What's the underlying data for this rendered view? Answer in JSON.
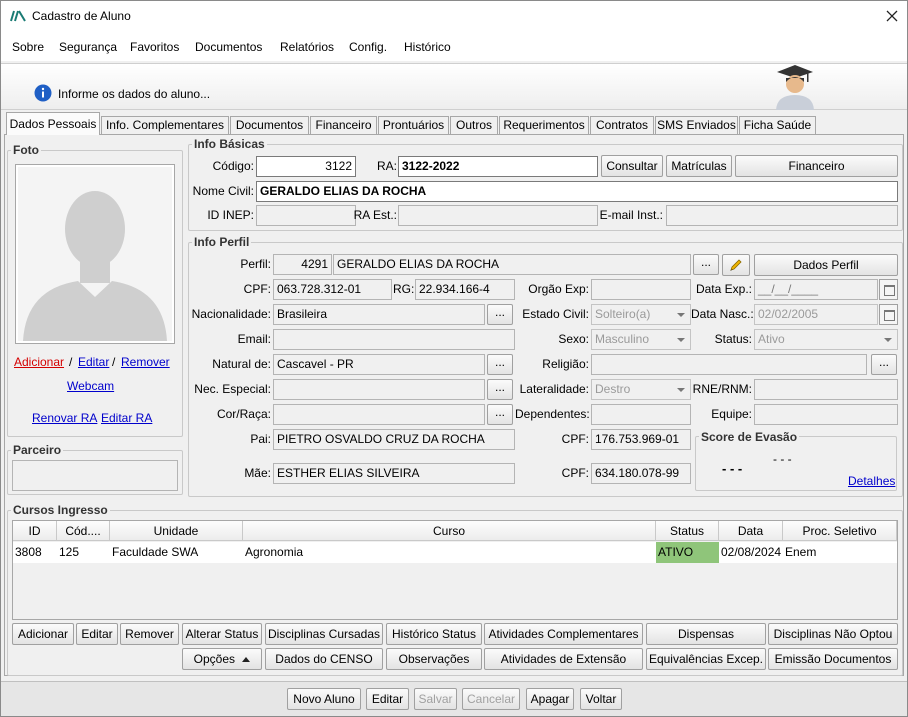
{
  "window": {
    "title": "Cadastro de Aluno"
  },
  "menu": [
    "Sobre",
    "Segurança",
    "Favoritos",
    "Documentos",
    "Relatórios",
    "Config.",
    "Histórico"
  ],
  "banner": {
    "message": "Informe os dados do aluno..."
  },
  "tabs": [
    "Dados Pessoais",
    "Info. Complementares",
    "Documentos",
    "Financeiro",
    "Prontuários",
    "Outros",
    "Requerimentos",
    "Contratos",
    "SMS Enviados",
    "Ficha Saúde"
  ],
  "foto": {
    "title": "Foto",
    "add": "Adicionar",
    "sep1": "/",
    "edit": "Editar",
    "sep2": "/",
    "remove": "Remover",
    "webcam": "Webcam",
    "renovar_ra": "Renovar RA",
    "editar_ra": "Editar RA"
  },
  "parceiro": {
    "title": "Parceiro",
    "value": ""
  },
  "info_basicas": {
    "title": "Info Básicas",
    "codigo_label": "Código:",
    "codigo": "3122",
    "ra_label": "RA:",
    "ra": "3122-2022",
    "consultar": "Consultar",
    "matriculas": "Matrículas",
    "financeiro": "Financeiro",
    "nome_label": "Nome Civil:",
    "nome": "GERALDO ELIAS DA ROCHA",
    "inep_label": "ID INEP:",
    "inep": "",
    "ra_est_label": "RA Est.:",
    "ra_est": "",
    "email_inst_label": "E-mail Inst.:",
    "email_inst": ""
  },
  "info_perfil": {
    "title": "Info Perfil",
    "perfil_label": "Perfil:",
    "perfil_id": "4291",
    "perfil_nome": "GERALDO ELIAS DA ROCHA",
    "ellipsis": "...",
    "dados_perfil": "Dados Perfil",
    "cpf_label": "CPF:",
    "cpf": "063.728.312-01",
    "rg_label": "RG:",
    "rg": "22.934.166-4",
    "orgao_label": "Orgão Exp:",
    "orgao": "",
    "data_exp_label": "Data Exp.:",
    "data_exp": "__/__/____",
    "nacionalidade_label": "Nacionalidade:",
    "nacionalidade": "Brasileira",
    "estado_civil_label": "Estado Civil:",
    "estado_civil": "Solteiro(a)",
    "data_nasc_label": "Data Nasc.:",
    "data_nasc": "02/02/2005",
    "email_label": "Email:",
    "email": "",
    "sexo_label": "Sexo:",
    "sexo": "Masculino",
    "status_label": "Status:",
    "status": "Ativo",
    "natural_label": "Natural de:",
    "natural": "Cascavel - PR",
    "religiao_label": "Religião:",
    "religiao": "",
    "nec_label": "Nec. Especial:",
    "nec": "",
    "lateralidade_label": "Lateralidade:",
    "lateralidade": "Destro",
    "rne_label": "RNE/RNM:",
    "rne": "",
    "cor_label": "Cor/Raça:",
    "cor": "",
    "dependentes_label": "Dependentes:",
    "dependentes": "",
    "equipe_label": "Equipe:",
    "equipe": "",
    "pai_label": "Pai:",
    "pai": "PIETRO OSVALDO CRUZ DA ROCHA",
    "cpf_pai_label": "CPF:",
    "cpf_pai": "176.753.969-01",
    "mae_label": "Mãe:",
    "mae": "ESTHER ELIAS SILVEIRA",
    "cpf_mae_label": "CPF:",
    "cpf_mae": "634.180.078-99"
  },
  "score": {
    "title": "Score de Evasão",
    "value1": "- - -",
    "value2": "- - -",
    "detalhes": "Detalhes"
  },
  "cursos": {
    "title": "Cursos Ingresso",
    "columns": [
      "ID",
      "Cód....",
      "Unidade",
      "Curso",
      "Status",
      "Data",
      "Proc. Seletivo"
    ],
    "rows": [
      [
        "3808",
        "125",
        "Faculdade SWA",
        "Agronomia",
        "ATIVO",
        "02/08/2024",
        "Enem"
      ]
    ]
  },
  "course_buttons_row1": [
    "Adicionar",
    "Editar",
    "Remover",
    "Alterar Status",
    "Disciplinas Cursadas",
    "Histórico Status",
    "Atividades Complementares",
    "Dispensas",
    "Disciplinas Não Optou"
  ],
  "course_buttons_row2": [
    "Opções",
    "Dados do CENSO",
    "Observações",
    "Atividades de Extensão",
    "Equivalências Excep.",
    "Emissão Documentos"
  ],
  "bottom_buttons": [
    "Novo Aluno",
    "Editar",
    "Salvar",
    "Cancelar",
    "Apagar",
    "Voltar"
  ],
  "colors": {
    "status_ativo": "#8fc57a",
    "link": "#0000cc",
    "add_link": "#d40000"
  }
}
